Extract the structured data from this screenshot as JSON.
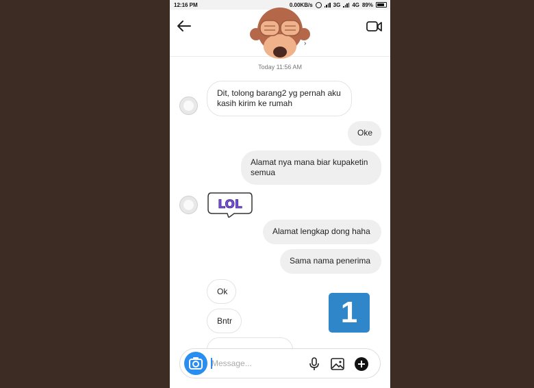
{
  "status_bar": {
    "time": "12:16 PM",
    "speed": "0.00KB/s",
    "network_3g": "3G",
    "network_4g": "4G",
    "battery": "89%"
  },
  "conversation": {
    "timestamp": "Today 11:56 AM"
  },
  "messages": [
    {
      "side": "in",
      "text": "Dit, tolong barang2 yg pernah aku kasih kirim ke rumah"
    },
    {
      "side": "out",
      "text": "Oke"
    },
    {
      "side": "out",
      "text": "Alamat nya mana biar kupaketin semua"
    },
    {
      "side": "in",
      "sticker": "LOL"
    },
    {
      "side": "out",
      "text": "Alamat lengkap dong haha"
    },
    {
      "side": "out",
      "text": "Sama nama penerima"
    },
    {
      "side": "in",
      "text": "Ok"
    },
    {
      "side": "in",
      "text": "Bntr"
    }
  ],
  "overlay_badge": "1",
  "composer": {
    "placeholder": "Message..."
  },
  "icons": {
    "back": "back-arrow-icon",
    "video": "video-call-icon",
    "camera": "camera-icon",
    "mic": "microphone-icon",
    "gallery": "gallery-icon",
    "plus": "plus-icon"
  },
  "colors": {
    "accent": "#2a8ef0",
    "badge": "#2f86c8",
    "background": "#3c2c24"
  }
}
